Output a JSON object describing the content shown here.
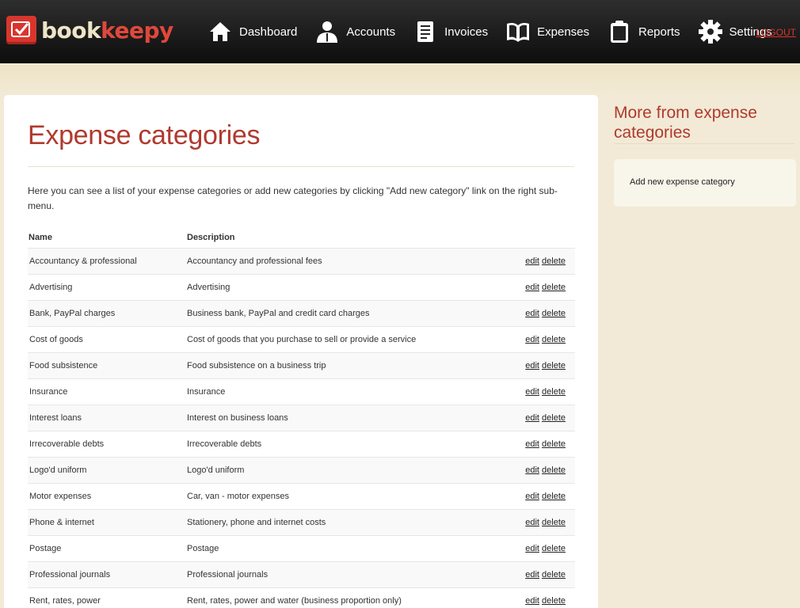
{
  "brand": {
    "part1": "book",
    "part2": "keepy"
  },
  "nav": [
    {
      "label": "Dashboard",
      "icon": "house-icon"
    },
    {
      "label": "Accounts",
      "icon": "user-icon"
    },
    {
      "label": "Invoices",
      "icon": "document-icon"
    },
    {
      "label": "Expenses",
      "icon": "book-icon"
    },
    {
      "label": "Reports",
      "icon": "clipboard-icon"
    },
    {
      "label": "Settings",
      "icon": "gear-icon"
    }
  ],
  "logout_label": "LOGOUT",
  "page": {
    "title": "Expense categories",
    "intro": "Here you can see a list of your expense categories or add new categories by clicking \"Add new category\" link on the right sub-menu."
  },
  "table": {
    "headers": {
      "name": "Name",
      "description": "Description"
    },
    "edit_label": "edit",
    "delete_label": "delete",
    "rows": [
      {
        "name": "Accountancy & professional",
        "description": "Accountancy and professional fees"
      },
      {
        "name": "Advertising",
        "description": "Advertising"
      },
      {
        "name": "Bank, PayPal charges",
        "description": "Business bank, PayPal and credit card charges"
      },
      {
        "name": "Cost of goods",
        "description": "Cost of goods that you purchase to sell or provide a service"
      },
      {
        "name": "Food subsistence",
        "description": "Food subsistence on a business trip"
      },
      {
        "name": "Insurance",
        "description": "Insurance"
      },
      {
        "name": "Interest loans",
        "description": "Interest on business loans"
      },
      {
        "name": "Irrecoverable debts",
        "description": "Irrecoverable debts"
      },
      {
        "name": "Logo'd uniform",
        "description": "Logo'd uniform"
      },
      {
        "name": "Motor expenses",
        "description": "Car, van - motor expenses"
      },
      {
        "name": "Phone & internet",
        "description": "Stationery, phone and internet costs"
      },
      {
        "name": "Postage",
        "description": "Postage"
      },
      {
        "name": "Professional journals",
        "description": "Professional journals"
      },
      {
        "name": "Rent, rates, power",
        "description": "Rent, rates, power and water (business proportion only)"
      }
    ]
  },
  "sidebar": {
    "title": "More from expense categories",
    "link": "Add new expense category"
  },
  "colors": {
    "accent": "#b03a2e",
    "brand_red": "#d8362d",
    "bg": "#f2ead6"
  }
}
